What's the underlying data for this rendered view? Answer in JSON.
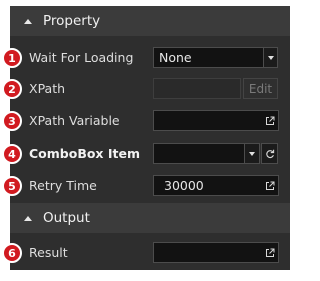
{
  "property_section": {
    "title": "Property"
  },
  "output_section": {
    "title": "Output"
  },
  "rows": [
    {
      "number": "1",
      "label": "Wait For Loading",
      "value": "None"
    },
    {
      "number": "2",
      "label": "XPath",
      "value": "",
      "button": "Edit"
    },
    {
      "number": "3",
      "label": "XPath Variable",
      "value": ""
    },
    {
      "number": "4",
      "label": "ComboBox Item",
      "value": ""
    },
    {
      "number": "5",
      "label": "Retry Time",
      "value": "30000"
    },
    {
      "number": "6",
      "label": "Result",
      "value": ""
    }
  ],
  "colors": {
    "badge": "#d11a20",
    "panel": "#2e2e2e",
    "header": "#3b3b3b"
  }
}
